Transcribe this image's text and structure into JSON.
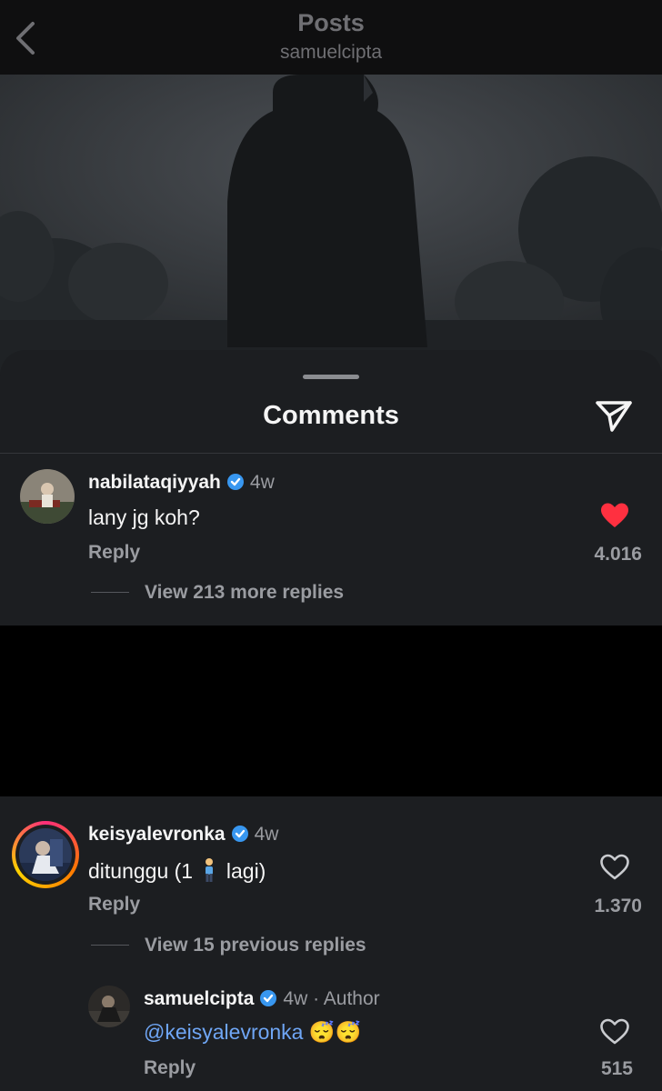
{
  "header": {
    "title": "Posts",
    "subtitle": "samuelcipta"
  },
  "sheet": {
    "title": "Comments"
  },
  "comments": [
    {
      "username": "nabilataqiyyah",
      "time": "4w",
      "text": "lany jg koh?",
      "reply_label": "Reply",
      "likes": "4.016",
      "liked": true,
      "view_replies": "View 213 more replies"
    },
    {
      "username": "keisyalevronka",
      "time": "4w",
      "text_before": "ditunggu (1",
      "text_after": "lagi)",
      "reply_label": "Reply",
      "likes": "1.370",
      "liked": false,
      "view_replies": "View 15 previous replies"
    }
  ],
  "reply": {
    "username": "samuelcipta",
    "time": "4w",
    "author_label": "· Author",
    "mention": "@keisyalevronka",
    "emoji": "😴😴",
    "reply_label": "Reply",
    "likes": "515",
    "liked": false
  },
  "colors": {
    "like_red": "#ff3040",
    "verified_blue": "#3897f0",
    "mention_blue": "#6fa6f5"
  }
}
